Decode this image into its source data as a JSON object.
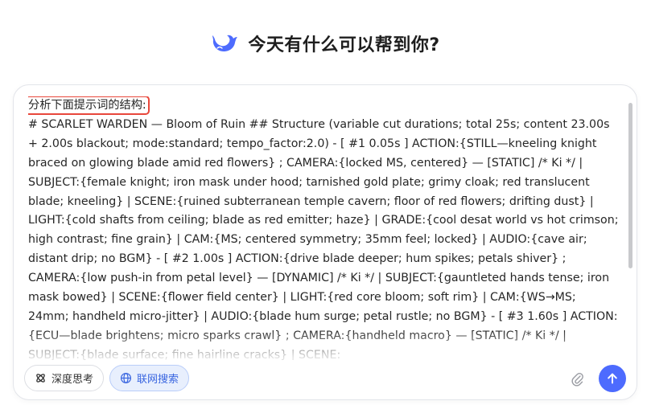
{
  "header": {
    "logo_icon": "whale-logo-icon",
    "title": "今天有什么可以帮到你?"
  },
  "input": {
    "highlighted_line": "分析下面提示词的结构:",
    "content": "# SCARLET WARDEN — Bloom of Ruin ## Structure (variable cut durations; total 25s; content 23.00s + 2.00s blackout; mode:standard; tempo_factor:2.0) - [ #1 0.05s ] ACTION:{STILL—kneeling knight braced on glowing blade amid red flowers} ; CAMERA:{locked MS, centered} — [STATIC] /* Ki */ | SUBJECT:{female knight; iron mask under hood; tarnished gold plate; grimy cloak; red translucent blade; kneeling} | SCENE:{ruined subterranean temple cavern; floor of red flowers; drifting dust} | LIGHT:{cold shafts from ceiling; blade as red emitter; haze} | GRADE:{cool desat world vs hot crimson; high contrast; fine grain} | CAM:{MS; centered symmetry; 35mm feel; locked} | AUDIO:{cave air; distant drip; no BGM} - [ #2 1.00s ] ACTION:{drive blade deeper; hum spikes; petals shiver} ; CAMERA:{low push-in from petal level} — [DYNAMIC] /* Ki */ | SUBJECT:{gauntleted hands tense; iron mask bowed} | SCENE:{flower field center} | LIGHT:{red core bloom; soft rim} | CAM:{WS→MS; 24mm; handheld micro-jitter} | AUDIO:{blade hum surge; petal rustle; no BGM} - [ #3 1.60s ] ACTION:{ECU—blade brightens; micro sparks crawl} ; CAMERA:{handheld macro} — [STATIC] /* Ki */ | SUBJECT:{blade surface; fine hairline cracks} | SCENE:"
  },
  "controls": {
    "deep_think_label": "深度思考",
    "deep_think_icon": "deep-think-icon",
    "web_search_label": "联网搜索",
    "web_search_icon": "globe-icon",
    "attach_icon": "paperclip-icon",
    "send_icon": "arrow-up-icon"
  },
  "colors": {
    "accent": "#4d6bfe",
    "highlight_box": "#e8473b",
    "search_active_bg": "#e8effd",
    "search_active_text": "#3a66e0"
  }
}
